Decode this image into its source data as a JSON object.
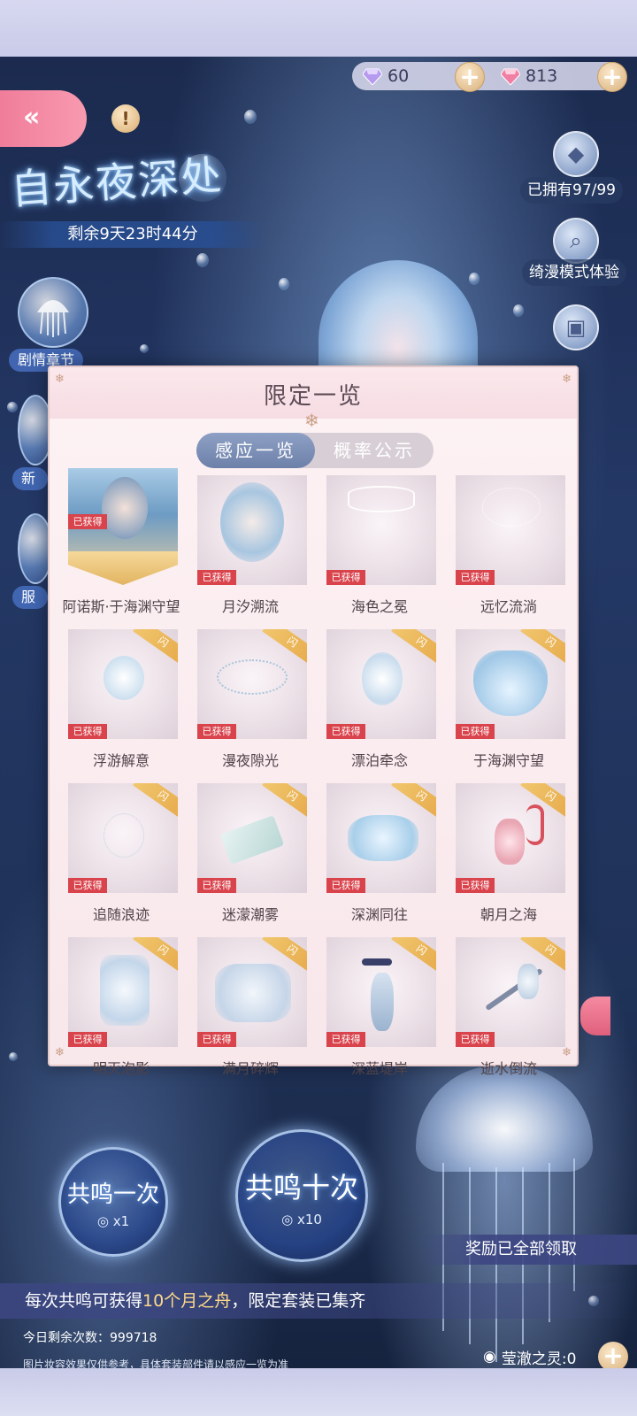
{
  "currency": {
    "diamond_purple": "60",
    "diamond_pink": "813"
  },
  "event": {
    "title": "自永夜深处",
    "countdown": "剩余9天23时44分"
  },
  "left_menu": {
    "story": "剧情章节",
    "new": "新",
    "outfit": "服"
  },
  "right_menu": {
    "owned": "已拥有97/99",
    "mode_trial": "绮漫模式体验"
  },
  "modal": {
    "title": "限定一览",
    "tabs": [
      "感应一览",
      "概率公示"
    ],
    "owned_tag": "已获得",
    "ribbon": "闪",
    "items": [
      "阿诺斯·于海渊守望",
      "月汐溯流",
      "海色之冕",
      "远忆流淌",
      "浮游解意",
      "漫夜隙光",
      "漂泊牵念",
      "于海渊守望",
      "追随浪迹",
      "迷濛潮雾",
      "深渊同往",
      "朝月之海",
      "明灭泡影",
      "满月碎辉",
      "深蓝堤岸",
      "逝水倒流"
    ]
  },
  "resonate": {
    "once_label": "共鸣一次",
    "once_count": "x1",
    "ten_label": "共鸣十次",
    "ten_count": "x10"
  },
  "reward_status": "奖励已全部领取",
  "notice": {
    "prefix": "每次共鸣可获得",
    "highlight": "10个月之舟",
    "suffix": "，限定套装已集齐"
  },
  "daily_remaining": "今日剩余次数：999718",
  "disclaimer": "图片妆容效果仅供参考，具体套装部件请以感应一览为准",
  "spirit": "莹澈之灵:0",
  "colors": {
    "accent_pink": "#f07d9a",
    "owned_red": "#d9434c",
    "gold": "#e6a94a",
    "tab_active": "#6d80a9"
  }
}
